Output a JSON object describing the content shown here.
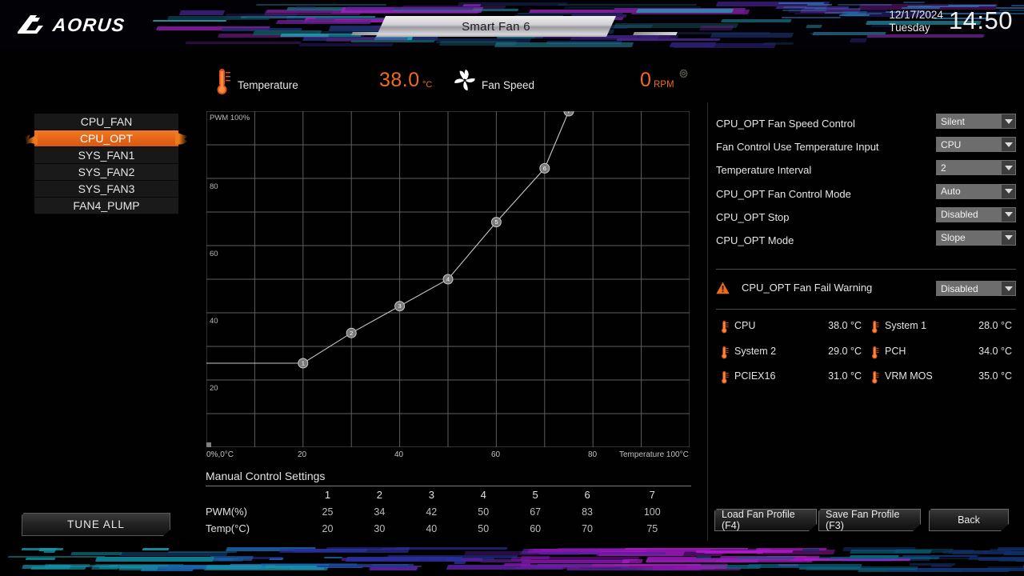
{
  "header": {
    "brand": "AORUS",
    "brand_icon": "aorus-falcon-icon",
    "page_title": "Smart Fan 6",
    "date": "12/17/2024",
    "weekday": "Tuesday",
    "time": "14:50"
  },
  "status": {
    "temperature_icon": "thermometer-icon",
    "temperature_label": "Temperature",
    "temperature_value": "38.0",
    "temperature_unit": "°C",
    "fan_icon": "fan-blades-icon",
    "fan_label": "Fan Speed",
    "rpm_value": "0",
    "rpm_unit": "RPM",
    "gear_icon": "gear-icon"
  },
  "fan_list": {
    "items": [
      {
        "label": "CPU_FAN",
        "selected": false
      },
      {
        "label": "CPU_OPT",
        "selected": true
      },
      {
        "label": "SYS_FAN1",
        "selected": false
      },
      {
        "label": "SYS_FAN2",
        "selected": false
      },
      {
        "label": "SYS_FAN3",
        "selected": false
      },
      {
        "label": "FAN4_PUMP",
        "selected": false
      }
    ]
  },
  "tune_all_label": "TUNE ALL",
  "chart_data": {
    "type": "line",
    "title": "",
    "xlabel": "Temperature 100°C",
    "ylabel": "PWM 100%",
    "origin_label": "0%,0°C",
    "x": [
      20,
      30,
      40,
      50,
      60,
      70,
      75
    ],
    "values": [
      25,
      34,
      42,
      50,
      67,
      83,
      100
    ],
    "point_labels": [
      "1",
      "2",
      "3",
      "4",
      "5",
      "6",
      "7"
    ],
    "xlim": [
      0,
      100
    ],
    "ylim": [
      0,
      100
    ],
    "x_ticks": [
      "20",
      "40",
      "60",
      "80"
    ],
    "x_tick_values": [
      20,
      40,
      60,
      80
    ],
    "y_ticks": [
      "80",
      "60",
      "40",
      "20"
    ],
    "y_tick_values": [
      80,
      60,
      40,
      20
    ],
    "grid": true,
    "grid_divisions": 10,
    "legend": "none",
    "line_color": "#c8c8c8",
    "point_color": "#7a7a7a"
  },
  "manual": {
    "title": "Manual Control Settings",
    "columns": [
      "1",
      "2",
      "3",
      "4",
      "5",
      "6",
      "7"
    ],
    "rows": [
      {
        "label": "PWM(%)",
        "values": [
          "25",
          "34",
          "42",
          "50",
          "67",
          "83",
          "100"
        ]
      },
      {
        "label": "Temp(°C)",
        "values": [
          "20",
          "30",
          "40",
          "50",
          "60",
          "70",
          "75"
        ]
      }
    ]
  },
  "settings": {
    "rows": [
      {
        "label": "CPU_OPT Fan Speed Control",
        "value": "Silent"
      },
      {
        "label": "Fan Control Use Temperature Input",
        "value": "CPU"
      },
      {
        "label": "Temperature Interval",
        "value": "2"
      },
      {
        "label": "CPU_OPT Fan Control Mode",
        "value": "Auto"
      },
      {
        "label": "CPU_OPT Stop",
        "value": "Disabled"
      },
      {
        "label": "CPU_OPT Mode",
        "value": "Slope"
      }
    ]
  },
  "warning": {
    "icon": "warning-triangle-icon",
    "label": "CPU_OPT Fan Fail Warning",
    "value": "Disabled"
  },
  "sensors": [
    {
      "icon": "thermometer-icon",
      "name": "CPU",
      "value": "38.0 °C"
    },
    {
      "icon": "thermometer-icon",
      "name": "System 1",
      "value": "28.0 °C"
    },
    {
      "icon": "thermometer-icon",
      "name": "System 2",
      "value": "29.0 °C"
    },
    {
      "icon": "thermometer-icon",
      "name": "PCH",
      "value": "34.0 °C"
    },
    {
      "icon": "thermometer-icon",
      "name": "PCIEX16",
      "value": "31.0 °C"
    },
    {
      "icon": "thermometer-icon",
      "name": "VRM MOS",
      "value": "35.0 °C"
    }
  ],
  "buttons": {
    "load": "Load Fan Profile (F4)",
    "save": "Save Fan Profile (F3)",
    "back": "Back"
  },
  "colors": {
    "accent_orange": "#ee6b1f",
    "selected_row": "#e5661a",
    "dropdown_bg": "#6d6d6d",
    "panel_bg": "#000000",
    "text": "#e6e6e6"
  }
}
